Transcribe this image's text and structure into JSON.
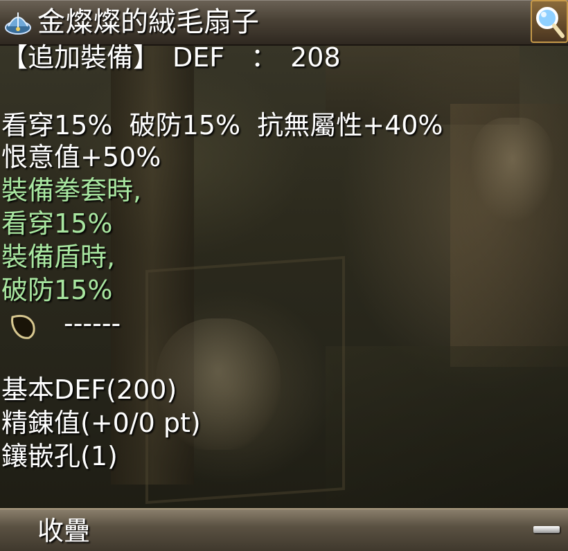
{
  "window": {
    "title": "金燦燦的絨毛扇子",
    "title_icon": "feather-fan-icon",
    "search_icon": "magnifier-icon"
  },
  "item": {
    "header_line": "【追加裝備】　DEF　：　208",
    "lines": [
      "看穿15%  破防15%  抗無屬性+40%",
      "恨意值+50%"
    ],
    "conditional_lines": [
      "裝備拳套時,",
      "看穿15%",
      "裝備盾時,",
      "破防15%"
    ],
    "slot_icon": "empty-card-slot-icon",
    "slot_text": "------",
    "base_lines": [
      "基本DEF(200)",
      "精錬值(+0/0 pt)",
      "鑲嵌孔(1)"
    ]
  },
  "footer": {
    "label": "收疊",
    "collapse_icon": "minus-icon"
  },
  "colors": {
    "text": "#ffffff",
    "conditional_text": "#a8e6a0",
    "titlebar": "#4a4236",
    "footer": "#5a5142"
  }
}
